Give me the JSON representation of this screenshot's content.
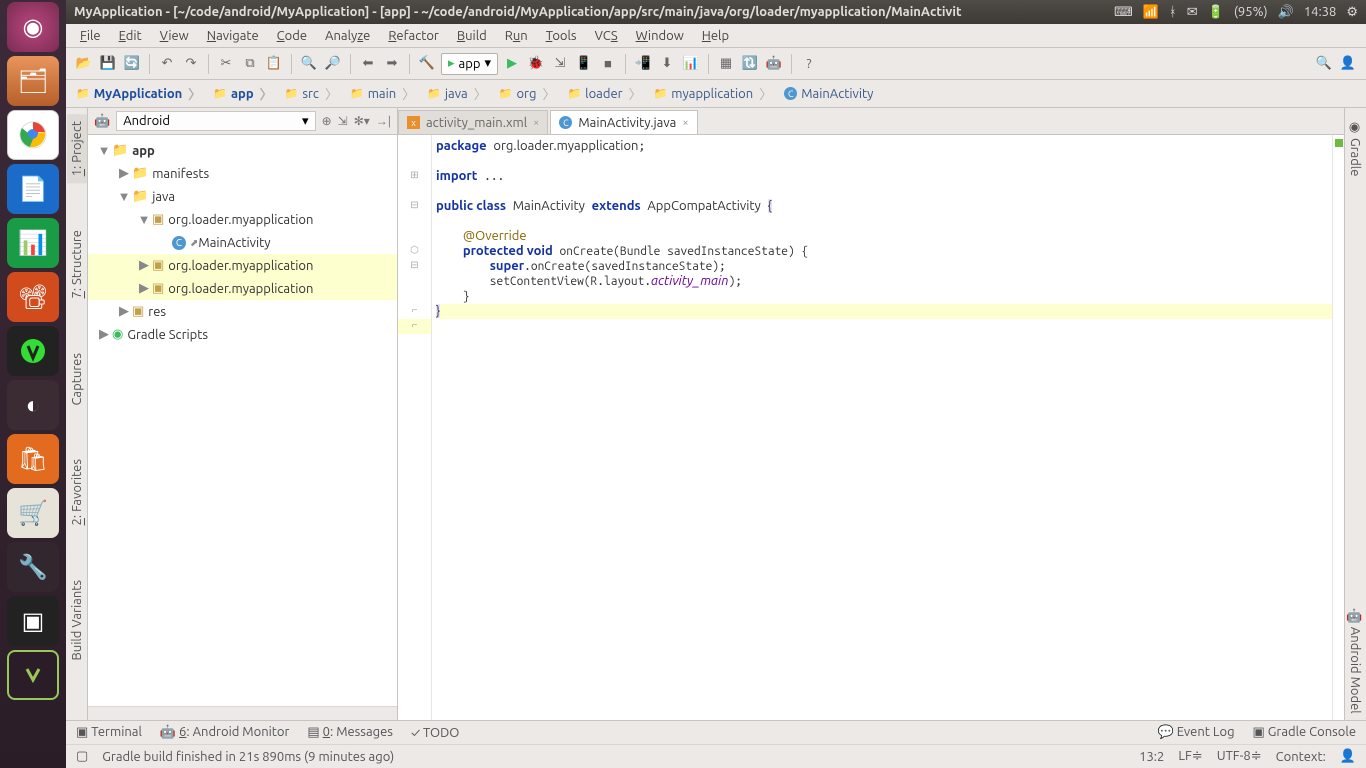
{
  "title": "MyApplication - [~/code/android/MyApplication] - [app] - ~/code/android/MyApplication/app/src/main/java/org/loader/myapplication/MainActivit",
  "battery": "(95%)",
  "time": "14:38",
  "menus": [
    "File",
    "Edit",
    "View",
    "Navigate",
    "Code",
    "Analyze",
    "Refactor",
    "Build",
    "Run",
    "Tools",
    "VCS",
    "Window",
    "Help"
  ],
  "run_config": "app",
  "breadcrumbs": [
    {
      "label": "MyApplication",
      "bold": true,
      "icon": "📁"
    },
    {
      "label": "app",
      "icon": "📁"
    },
    {
      "label": "src",
      "icon": "📁"
    },
    {
      "label": "main",
      "icon": "📁"
    },
    {
      "label": "java",
      "icon": "📁"
    },
    {
      "label": "org",
      "icon": "📁"
    },
    {
      "label": "loader",
      "icon": "📁"
    },
    {
      "label": "myapplication",
      "icon": "📁"
    },
    {
      "label": "MainActivity",
      "icon": "C"
    }
  ],
  "left_tabs": [
    "1: Project",
    "7: Structure",
    "Captures",
    "2: Favorites",
    "Build Variants"
  ],
  "right_tabs": [
    "Gradle",
    "Android Model"
  ],
  "project_view": "Android",
  "tree": {
    "app": "app",
    "manifests": "manifests",
    "java": "java",
    "pkg1": "org.loader.myapplication",
    "main_activity": "MainActivity",
    "pkg2": "org.loader.myapplication",
    "pkg3": "org.loader.myapplication",
    "res": "res",
    "gradle": "Gradle Scripts"
  },
  "tabs": [
    {
      "label": "activity_main.xml",
      "type": "xml"
    },
    {
      "label": "MainActivity.java",
      "type": "java"
    }
  ],
  "code": {
    "pkg": "org.loader.myapplication",
    "cls": "MainActivity",
    "ext": "AppCompatActivity",
    "layout": "activity_main"
  },
  "bottom": [
    "Terminal",
    "6: Android Monitor",
    "0: Messages",
    "TODO"
  ],
  "event_log": "Event Log",
  "status_msg": "Gradle build finished in 21s 890ms (9 minutes ago)",
  "pos": "13:2",
  "le": "LF",
  "enc": "UTF-8",
  "ctx": "Context:"
}
